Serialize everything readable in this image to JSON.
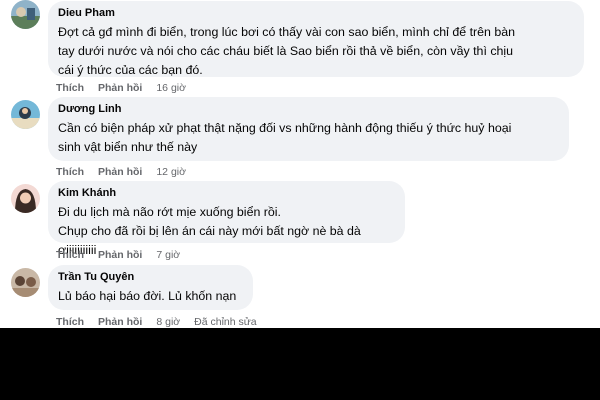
{
  "comments": [
    {
      "author": "Dieu Pham",
      "text": "Đợt cả gđ mình đi biển, trong lúc bơi có thấy vài con sao biển, mình chỉ để trên bàn\ntay dưới nước và nói cho các cháu biết là Sao biển rồi thả về biển, còn vầy thì chịu\ncái ý thức của các bạn đó.",
      "like_label": "Thích",
      "reply_label": "Phản hồi",
      "time": "16 giờ",
      "edited": ""
    },
    {
      "author": "Dương Linh",
      "text": "Cần có biện pháp xử phạt thật nặng đối vs những hành động thiếu ý thức huỷ hoại\nsinh vật biển như thế này",
      "like_label": "Thích",
      "reply_label": "Phản hồi",
      "time": "12 giờ",
      "edited": ""
    },
    {
      "author": "Kim Khánh",
      "text": "Đi du lịch mà não rớt mịe xuống biển rồi.\nChụp cho đã rồi bị lên án cái này mới bất ngờ nè bà dà ơiiiiiiiiiii",
      "like_label": "Thích",
      "reply_label": "Phản hồi",
      "time": "7 giờ",
      "edited": ""
    },
    {
      "author": "Trần Tu Quyên",
      "text": "Lủ báo hại báo đời. Lủ khốn nạn",
      "like_label": "Thích",
      "reply_label": "Phản hồi",
      "time": "8 giờ",
      "edited": "Đã chỉnh sửa"
    }
  ],
  "colors": {
    "bubble": "#f0f2f5",
    "meta_text": "#65676b",
    "text": "#050505",
    "bottom_bar": "#000000"
  }
}
